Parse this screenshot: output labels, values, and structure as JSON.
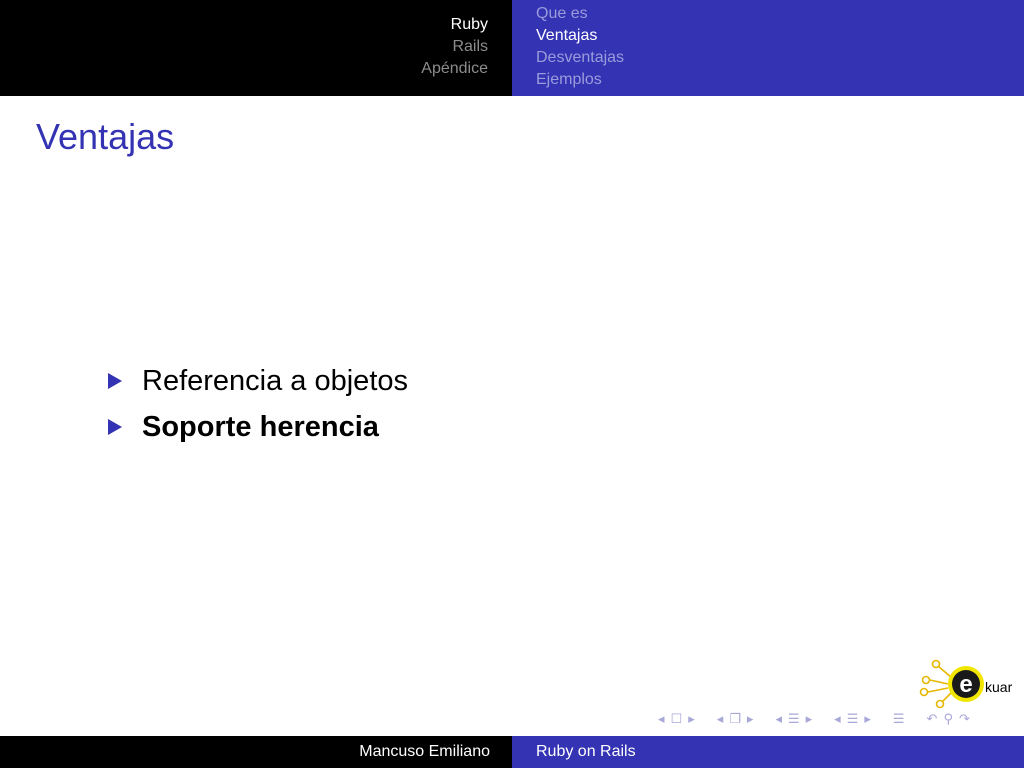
{
  "header": {
    "sections": [
      {
        "label": "Ruby",
        "active": true
      },
      {
        "label": "Rails",
        "active": false
      },
      {
        "label": "Apéndice",
        "active": false
      }
    ],
    "subsections": [
      {
        "label": "Que es",
        "active": false
      },
      {
        "label": "Ventajas",
        "active": true
      },
      {
        "label": "Desventajas",
        "active": false
      },
      {
        "label": "Ejemplos",
        "active": false
      }
    ]
  },
  "frame": {
    "title": "Ventajas",
    "bullets": [
      {
        "text": "Referencia a objetos",
        "bold": false
      },
      {
        "text": "Soporte herencia",
        "bold": true
      }
    ]
  },
  "logo": {
    "text": "kuar",
    "letter": "e"
  },
  "footer": {
    "author": "Mancuso Emiliano",
    "title": "Ruby on Rails"
  },
  "colors": {
    "accent": "#3333b3",
    "header_dark": "#000000",
    "logo_yellow": "#f2e600"
  }
}
